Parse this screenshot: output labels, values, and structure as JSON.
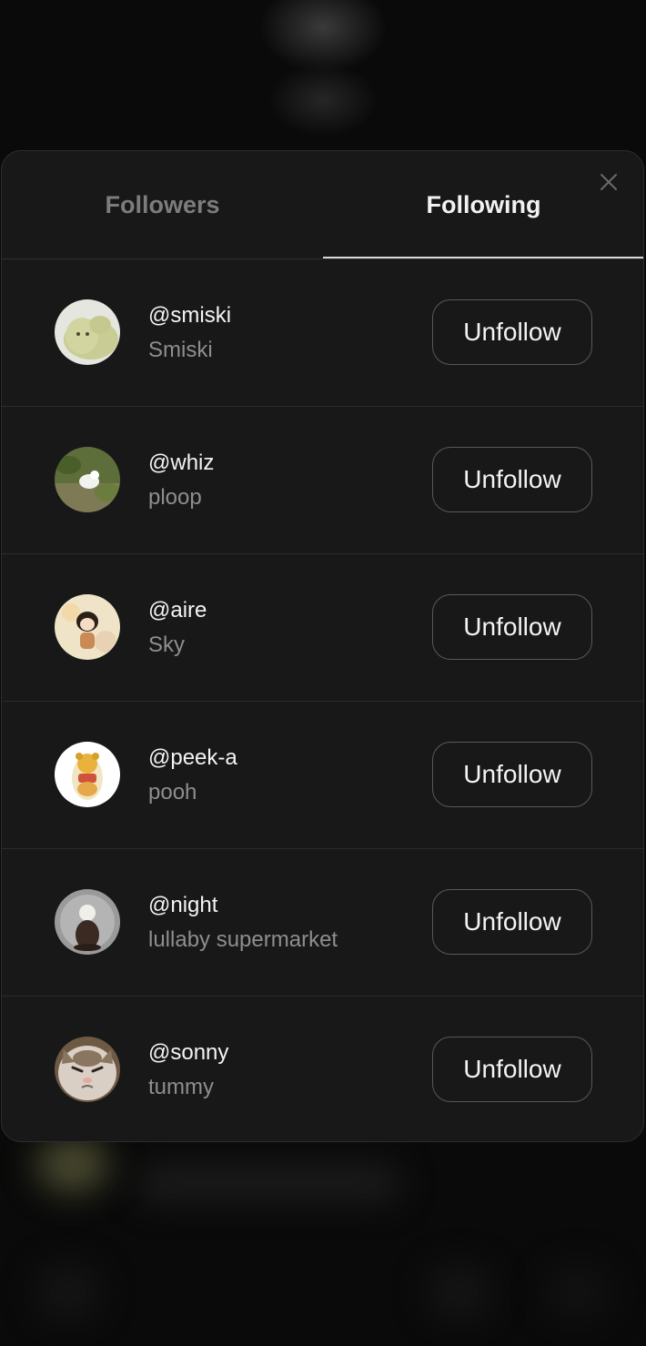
{
  "tabs": [
    {
      "label": "Followers",
      "active": false
    },
    {
      "label": "Following",
      "active": true
    }
  ],
  "close_icon": "close-icon",
  "following": [
    {
      "handle": "@smiski",
      "name": "Smiski",
      "button": "Unfollow",
      "avatar": "smiski-figure"
    },
    {
      "handle": "@whiz",
      "name": "ploop",
      "button": "Unfollow",
      "avatar": "white-dog-on-grass"
    },
    {
      "handle": "@aire",
      "name": "Sky",
      "button": "Unfollow",
      "avatar": "girl-figurine"
    },
    {
      "handle": "@peek-a",
      "name": "pooh",
      "button": "Unfollow",
      "avatar": "pooh-figure"
    },
    {
      "handle": "@night",
      "name": "lullaby supermarket",
      "button": "Unfollow",
      "avatar": "grey-figurine"
    },
    {
      "handle": "@sonny",
      "name": "tummy",
      "button": "Unfollow",
      "avatar": "grumpy-cat"
    }
  ],
  "colors": {
    "modal_bg": "#181818",
    "active_tab": "#f2f2f2",
    "inactive_tab": "#7c7c7c",
    "secondary_text": "#8e8e8e",
    "button_border": "#595959"
  }
}
